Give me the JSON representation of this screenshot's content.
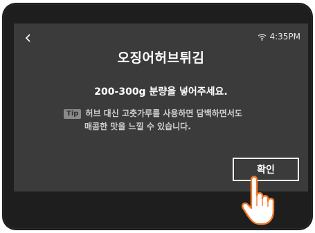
{
  "status": {
    "wifi_icon": "wifi-icon",
    "time": "4:35PM"
  },
  "back_icon": "chevron-left-icon",
  "title": "오징어허브튀김",
  "instruction": "200-300g 분량을 넣어주세요.",
  "tip": {
    "badge": "Tip",
    "line1": "허브 대신 고춧가루를 사용하면 담백하면서도",
    "line2": "매콤한 맛을 느낄 수 있습니다."
  },
  "confirm_label": "확인",
  "colors": {
    "bezel": "#1e1e1e",
    "screen": "#3b3b3b",
    "hand_fill": "#ffffff",
    "hand_outline": "#f07a2a"
  }
}
